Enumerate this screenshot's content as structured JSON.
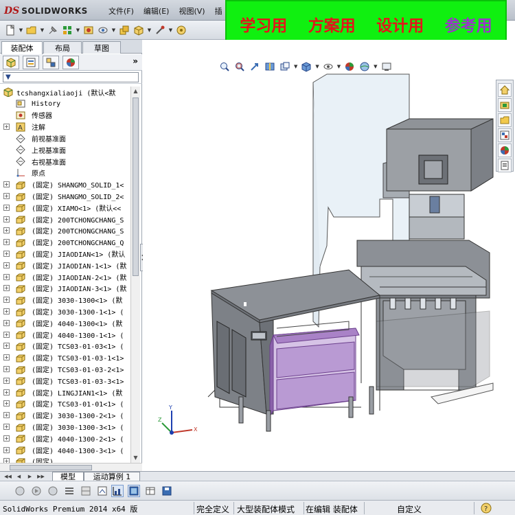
{
  "app": {
    "logo_mark": "DS",
    "logo_text": "SOLIDWORKS",
    "menus": [
      "文件(F)",
      "编辑(E)",
      "视图(V)",
      "插"
    ]
  },
  "banner": {
    "items": [
      {
        "text": "学习用",
        "color": "#e3151a"
      },
      {
        "text": "方案用",
        "color": "#e3151a"
      },
      {
        "text": "设计用",
        "color": "#e3151a"
      },
      {
        "text": "参考用",
        "color": "#9a35c9"
      }
    ],
    "background": "#10f010"
  },
  "panel": {
    "tabs": [
      "装配体",
      "布局",
      "草图"
    ],
    "active_tab": "装配体",
    "expand_label": "»",
    "filter_icon": "▼"
  },
  "tree": {
    "root": "tcshangxialiaoji  (默认<默",
    "items": [
      {
        "label": "History",
        "icon": "history-icon",
        "expander": false
      },
      {
        "label": "传感器",
        "icon": "sensor-icon",
        "expander": false
      },
      {
        "label": "注解",
        "icon": "annotation-icon",
        "expander": true
      },
      {
        "label": "前视基准面",
        "icon": "plane-icon",
        "expander": false
      },
      {
        "label": "上视基准面",
        "icon": "plane-icon",
        "expander": false
      },
      {
        "label": "右视基准面",
        "icon": "plane-icon",
        "expander": false
      },
      {
        "label": "原点",
        "icon": "origin-icon",
        "expander": false
      },
      {
        "label": "(固定) SHANGMO_SOLID_1<",
        "icon": "part-icon",
        "expander": true
      },
      {
        "label": "(固定) SHANGMO_SOLID_2<",
        "icon": "part-icon",
        "expander": true
      },
      {
        "label": "(固定) XIAMO<1> (默认<<",
        "icon": "part-icon",
        "expander": true
      },
      {
        "label": "(固定) 200TCHONGCHANG_S",
        "icon": "part-icon",
        "expander": true
      },
      {
        "label": "(固定) 200TCHONGCHANG_S",
        "icon": "part-icon",
        "expander": true
      },
      {
        "label": "(固定) 200TCHONGCHANG_Q",
        "icon": "part-icon",
        "expander": true
      },
      {
        "label": "(固定) JIAODIAN<1> (默认",
        "icon": "part-icon",
        "expander": true
      },
      {
        "label": "(固定) JIAODIAN-1<1> (默",
        "icon": "part-icon",
        "expander": true
      },
      {
        "label": "(固定) JIAODIAN-2<1> (默",
        "icon": "part-icon",
        "expander": true
      },
      {
        "label": "(固定) JIAODIAN-3<1> (默",
        "icon": "part-icon",
        "expander": true
      },
      {
        "label": "(固定) 3030-1300<1> (默",
        "icon": "part-icon",
        "expander": true
      },
      {
        "label": "(固定) 3030-1300-1<1> (",
        "icon": "part-icon",
        "expander": true
      },
      {
        "label": "(固定) 4040-1300<1> (默",
        "icon": "part-icon",
        "expander": true
      },
      {
        "label": "(固定) 4040-1300-1<1> (",
        "icon": "part-icon",
        "expander": true
      },
      {
        "label": "(固定) TCS03-01-03<1> (",
        "icon": "part-icon",
        "expander": true
      },
      {
        "label": "(固定) TCS03-01-03-1<1>",
        "icon": "part-icon",
        "expander": true
      },
      {
        "label": "(固定) TCS03-01-03-2<1>",
        "icon": "part-icon",
        "expander": true
      },
      {
        "label": "(固定) TCS03-01-03-3<1>",
        "icon": "part-icon",
        "expander": true
      },
      {
        "label": "(固定) LINGJIAN1<1> (默",
        "icon": "part-icon",
        "expander": true
      },
      {
        "label": "(固定) TCS03-01-01<1> (",
        "icon": "part-icon",
        "expander": true
      },
      {
        "label": "(固定) 3030-1300-2<1> (",
        "icon": "part-icon",
        "expander": true
      },
      {
        "label": "(固定) 3030-1300-3<1> (",
        "icon": "part-icon",
        "expander": true
      },
      {
        "label": "(固定) 4040-1300-2<1> (",
        "icon": "part-icon",
        "expander": true
      },
      {
        "label": "(固定) 4040-1300-3<1> (",
        "icon": "part-icon",
        "expander": true
      },
      {
        "label": "(固定) ",
        "icon": "part-icon",
        "expander": true
      }
    ]
  },
  "bottom_tabs": [
    "模型",
    "运动算例 1"
  ],
  "status": {
    "product": "SolidWorks Premium 2014 x64 版",
    "definition": "完全定义",
    "mode": "大型装配体模式",
    "editing": "在编辑 装配体",
    "units": "自定义"
  },
  "colors": {
    "machine_frame": "#8f9398",
    "machine_light": "#e8f0f6",
    "press_face": "#c4c9d0",
    "cabinet": "#7d8187",
    "drawer_frame": "#a982c7"
  }
}
